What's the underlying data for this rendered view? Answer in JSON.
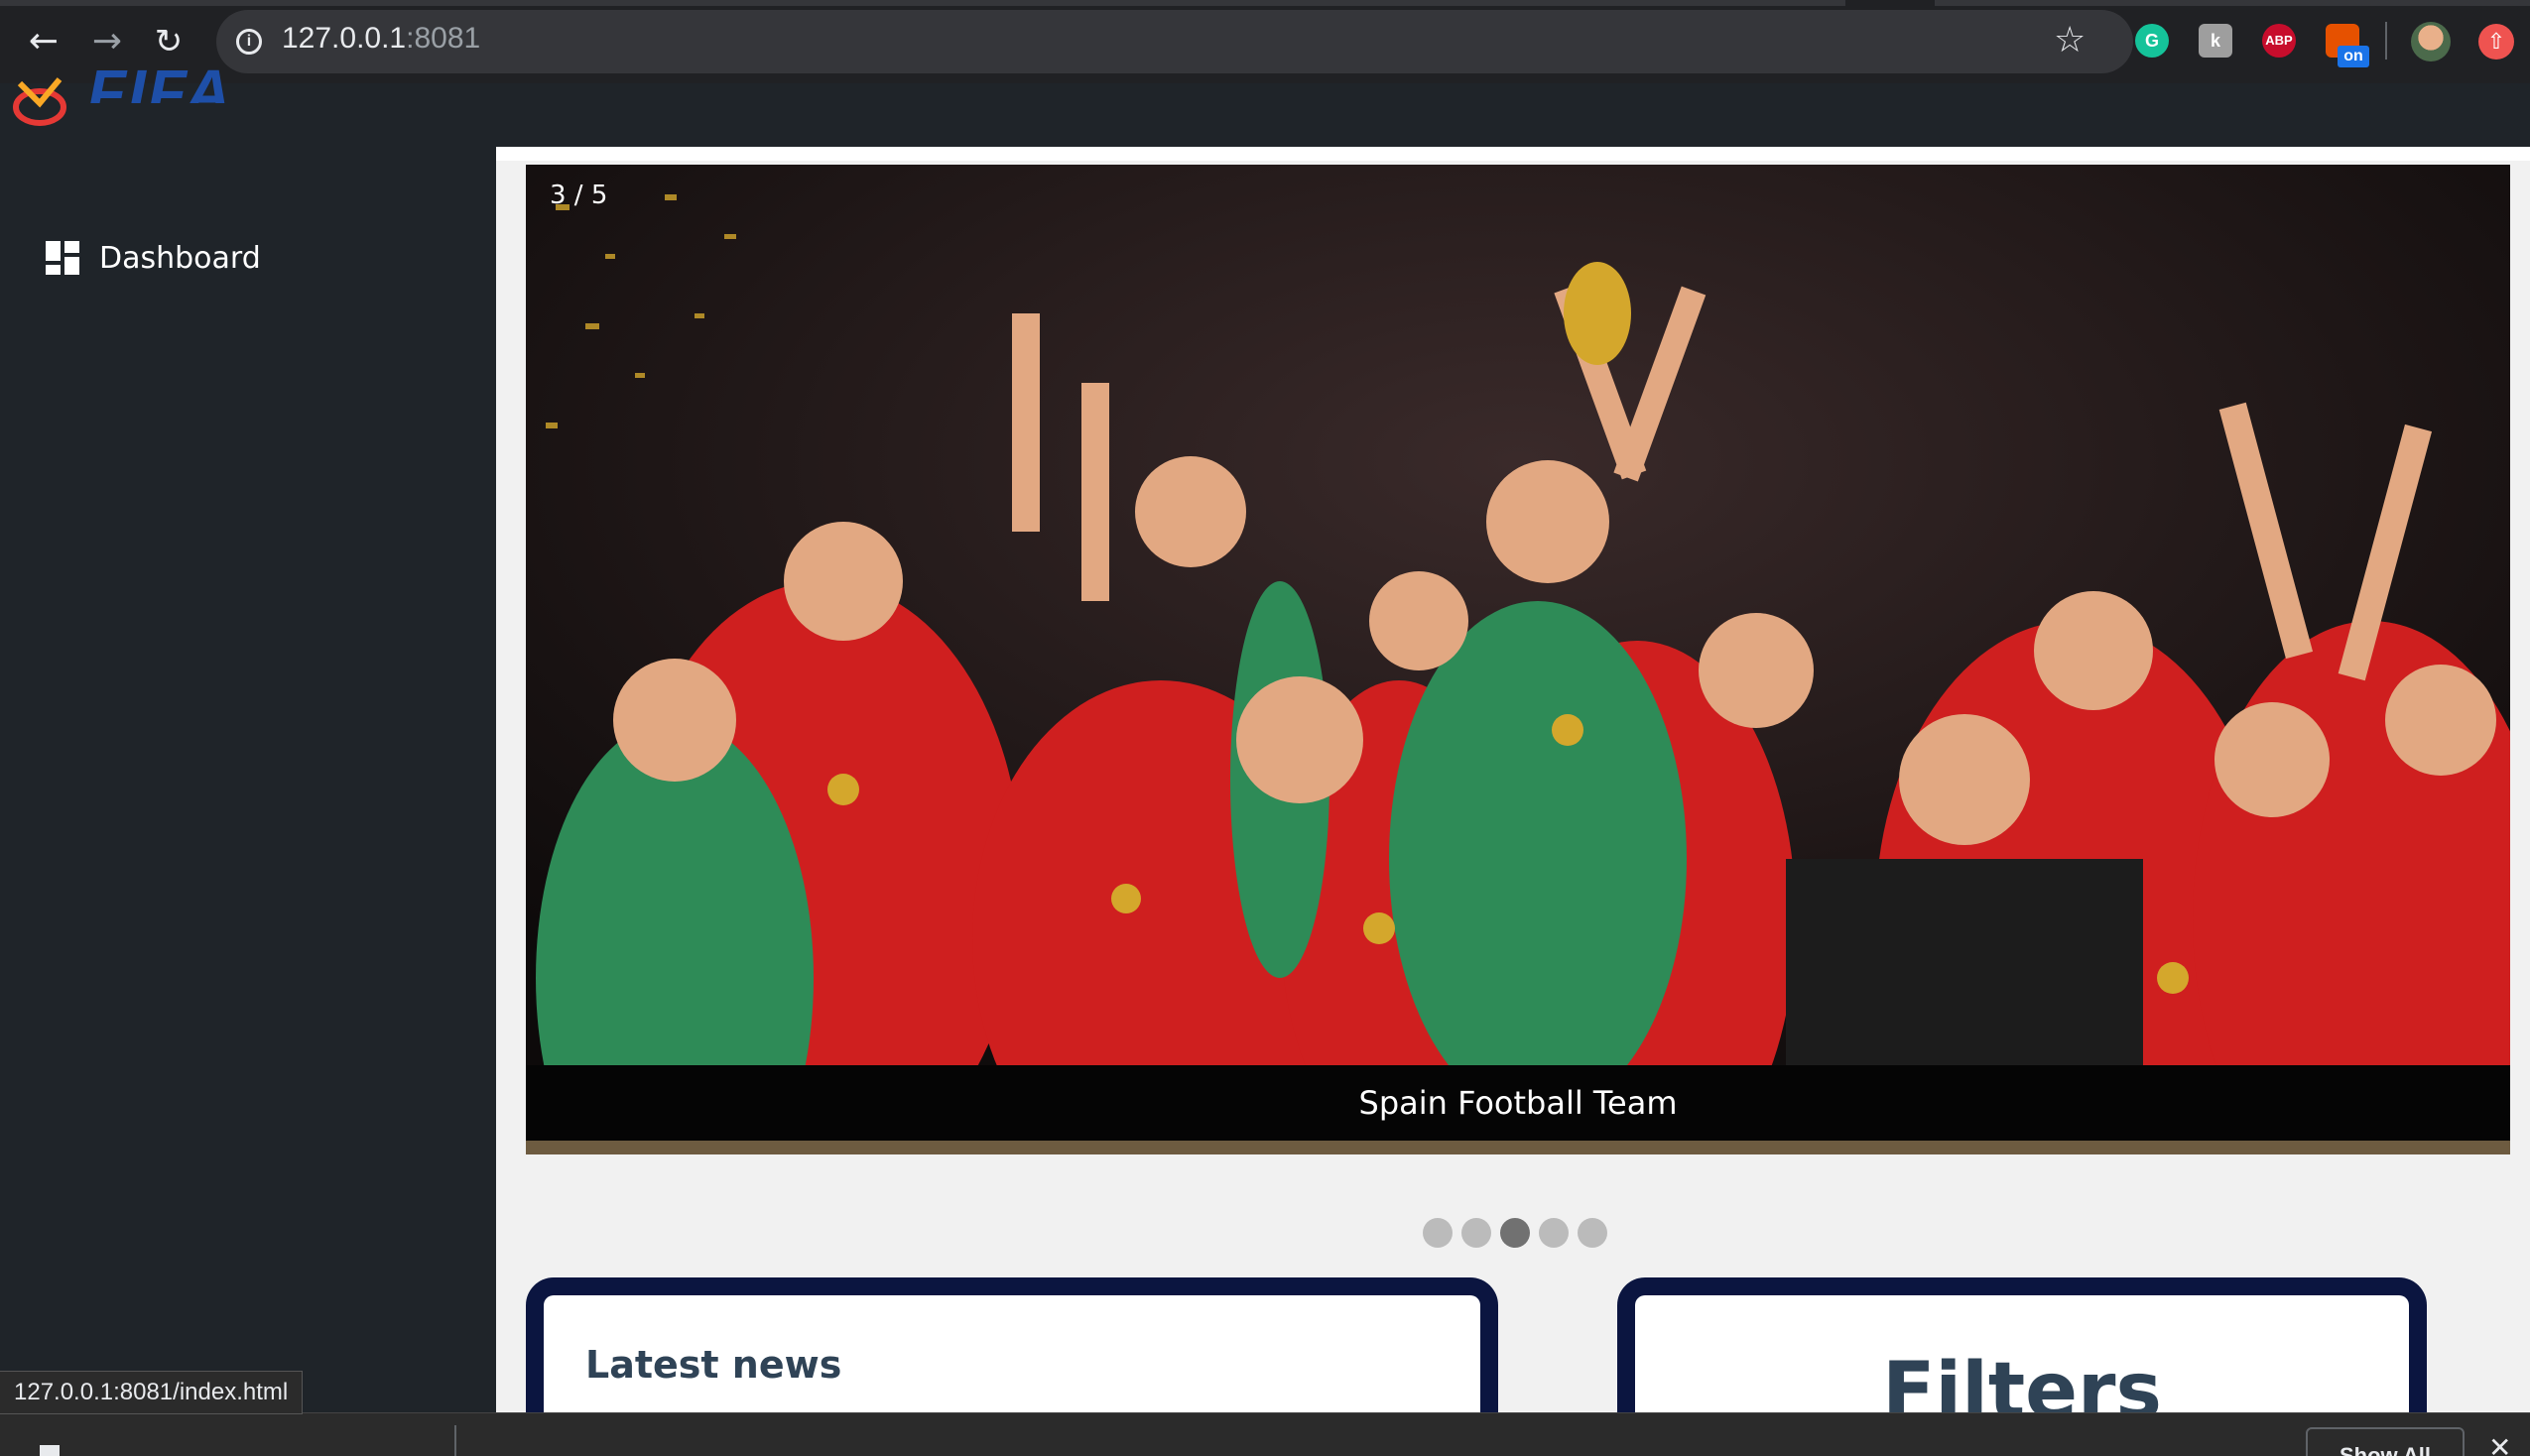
{
  "browser": {
    "url_host": "127.0.0.1",
    "url_port": ":8081",
    "extensions": [
      "grammarly-icon",
      "extension-k-icon",
      "adblock-icon",
      "office-on-icon",
      "profile-avatar",
      "update-icon"
    ],
    "ext_badge": "on",
    "ext_abp_label": "ABP"
  },
  "app": {
    "logo_text": "FIFA",
    "sidebar": {
      "items": [
        {
          "label": "Dashboard",
          "icon": "dashboard-icon"
        }
      ]
    }
  },
  "slideshow": {
    "counter": "3 / 5",
    "caption": "Spain Football Team",
    "dots_total": 5,
    "active_dot": 3
  },
  "cards": {
    "news_title": "Latest news",
    "filters_title": "Filters"
  },
  "status": {
    "hover_url": "127.0.0.1:8081/index.html",
    "show_all": "Show All"
  },
  "colors": {
    "sidebar_bg": "#1f2429",
    "card_border": "#0b1540",
    "title_text": "#2f4356",
    "logo": "#1e4fa8"
  }
}
